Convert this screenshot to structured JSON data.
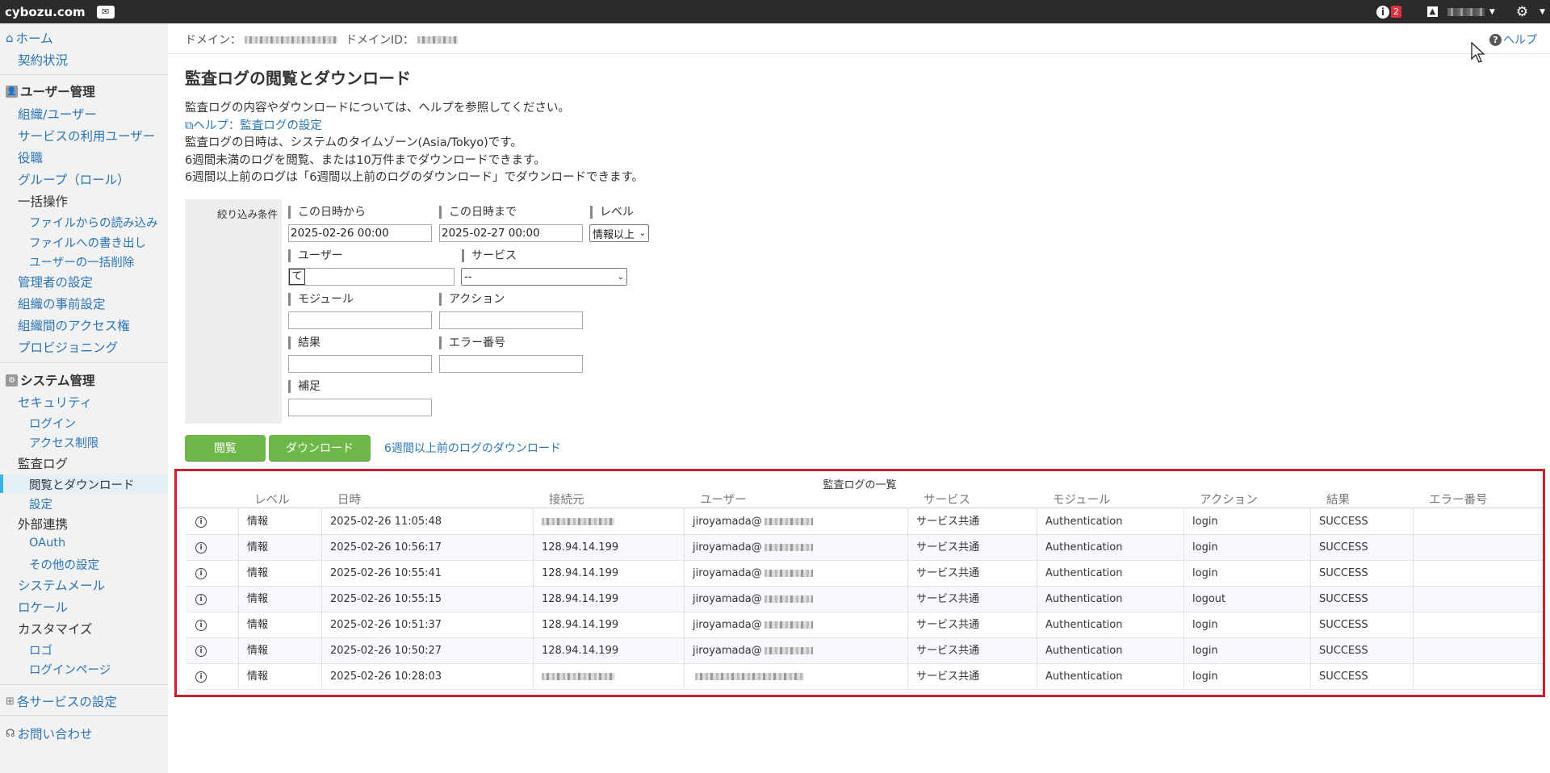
{
  "topbar": {
    "logo": "cybozu.com",
    "notifications": "2"
  },
  "sidebar": {
    "home": "ホーム",
    "contract": "契約状況",
    "user_mgmt": "ユーザー管理",
    "user_items": [
      "組織/ユーザー",
      "サービスの利用ユーザー",
      "役職",
      "グループ（ロール）"
    ],
    "bulk": "一括操作",
    "bulk_items": [
      "ファイルからの読み込み",
      "ファイルへの書き出し",
      "ユーザーの一括削除"
    ],
    "user_items2": [
      "管理者の設定",
      "組織の事前設定",
      "組織間のアクセス権",
      "プロビジョニング"
    ],
    "system_mgmt": "システム管理",
    "security": "セキュリティ",
    "security_items": [
      "ログイン",
      "アクセス制限"
    ],
    "audit_log": "監査ログ",
    "audit_items": [
      "閲覧とダウンロード",
      "設定"
    ],
    "external": "外部連携",
    "external_items": [
      "OAuth",
      "その他の設定"
    ],
    "system_items": [
      "システムメール",
      "ロケール",
      "カスタマイズ"
    ],
    "customize_items": [
      "ロゴ",
      "ログインページ"
    ],
    "service_settings": "各サービスの設定",
    "contact": "お問い合わせ"
  },
  "header": {
    "domain_label": "ドメイン：",
    "domain_id_label": "ドメインID：",
    "help": "ヘルプ"
  },
  "page": {
    "title": "監査ログの閲覧とダウンロード",
    "desc1": "監査ログの内容やダウンロードについては、ヘルプを参照してください。",
    "help_link": "ヘルプ：監査ログの設定",
    "desc2": "監査ログの日時は、システムのタイムゾーン(Asia/Tokyo)です。",
    "desc3": "6週間未満のログを閲覧、または10万件までダウンロードできます。",
    "desc4": "6週間以上前のログは「6週間以上前のログのダウンロード」でダウンロードできます。"
  },
  "filter": {
    "title": "絞り込み条件",
    "from_label": "この日時から",
    "from_value": "2025-02-26 00:00",
    "to_label": "この日時まで",
    "to_value": "2025-02-27 00:00",
    "level_label": "レベル",
    "level_value": "情報以上",
    "user_label": "ユーザー",
    "user_value": "て",
    "service_label": "サービス",
    "service_value": "--",
    "module_label": "モジュール",
    "action_label": "アクション",
    "result_label": "結果",
    "error_label": "エラー番号",
    "note_label": "補足"
  },
  "buttons": {
    "view": "閲覧",
    "download": "ダウンロード",
    "old_download": "6週間以上前のログのダウンロード"
  },
  "table": {
    "caption": "監査ログの一覧",
    "headers": [
      "レベル",
      "日時",
      "接続元",
      "ユーザー",
      "サービス",
      "モジュール",
      "アクション",
      "結果",
      "エラー番号"
    ],
    "rows": [
      {
        "level": "情報",
        "datetime": "2025-02-26 11:05:48",
        "source": "",
        "user": "jiroyamada@",
        "service": "サービス共通",
        "module": "Authentication",
        "action": "login",
        "result": "SUCCESS",
        "error": ""
      },
      {
        "level": "情報",
        "datetime": "2025-02-26 10:56:17",
        "source": "128.94.14.199",
        "user": "jiroyamada@",
        "service": "サービス共通",
        "module": "Authentication",
        "action": "login",
        "result": "SUCCESS",
        "error": ""
      },
      {
        "level": "情報",
        "datetime": "2025-02-26 10:55:41",
        "source": "128.94.14.199",
        "user": "jiroyamada@",
        "service": "サービス共通",
        "module": "Authentication",
        "action": "login",
        "result": "SUCCESS",
        "error": ""
      },
      {
        "level": "情報",
        "datetime": "2025-02-26 10:55:15",
        "source": "128.94.14.199",
        "user": "jiroyamada@",
        "service": "サービス共通",
        "module": "Authentication",
        "action": "logout",
        "result": "SUCCESS",
        "error": ""
      },
      {
        "level": "情報",
        "datetime": "2025-02-26 10:51:37",
        "source": "128.94.14.199",
        "user": "jiroyamada@",
        "service": "サービス共通",
        "module": "Authentication",
        "action": "login",
        "result": "SUCCESS",
        "error": ""
      },
      {
        "level": "情報",
        "datetime": "2025-02-26 10:50:27",
        "source": "128.94.14.199",
        "user": "jiroyamada@",
        "service": "サービス共通",
        "module": "Authentication",
        "action": "login",
        "result": "SUCCESS",
        "error": ""
      },
      {
        "level": "情報",
        "datetime": "2025-02-26 10:28:03",
        "source": "",
        "user": "",
        "service": "サービス共通",
        "module": "Authentication",
        "action": "login",
        "result": "SUCCESS",
        "error": ""
      }
    ]
  },
  "colors": {
    "link": "#2a75b8",
    "button": "#6eb84a",
    "highlight_border": "#cc1f2b",
    "topbar": "#2b2b2b"
  }
}
